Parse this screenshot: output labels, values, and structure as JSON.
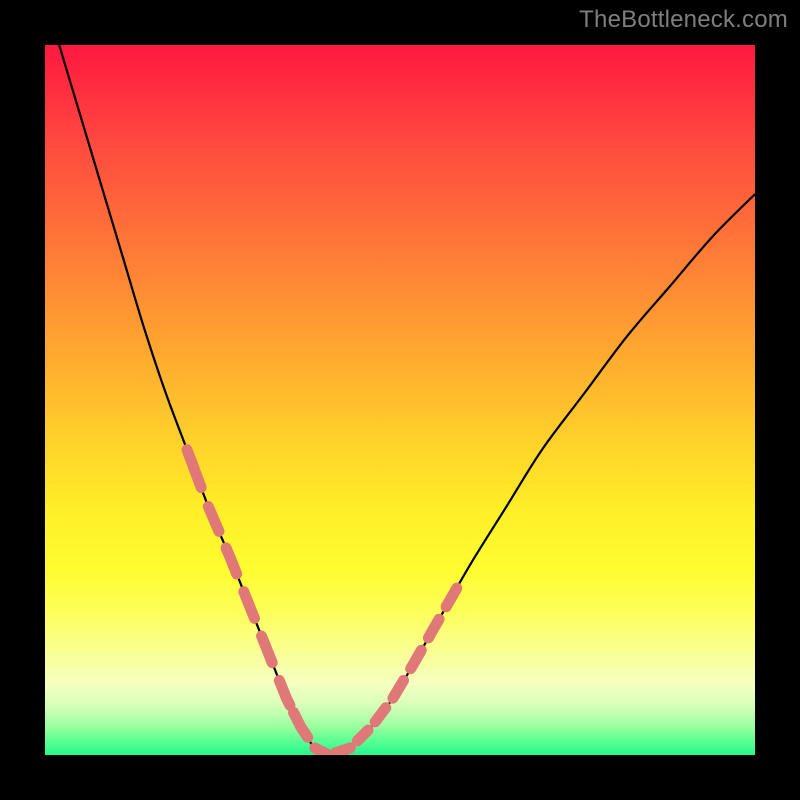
{
  "watermark": "TheBottleneck.com",
  "colors": {
    "frame": "#000000",
    "watermark_text": "#7e7e7e",
    "curve": "#000000",
    "dash": "#e07878",
    "gradient_top": "#ff1840",
    "gradient_bottom": "#22f98d"
  },
  "chart_data": {
    "type": "line",
    "title": "",
    "xlabel": "",
    "ylabel": "",
    "xlim": [
      0,
      100
    ],
    "ylim": [
      0,
      100
    ],
    "grid": false,
    "legend": false,
    "annotations": [],
    "series": [
      {
        "name": "bottleneck-curve",
        "x": [
          2,
          5,
          8,
          11,
          14,
          17,
          20,
          23,
          26,
          28,
          30,
          32,
          34,
          36,
          38,
          40,
          43,
          46,
          49,
          52,
          56,
          60,
          65,
          70,
          76,
          82,
          88,
          94,
          100
        ],
        "y": [
          100,
          90,
          80,
          70,
          60,
          51,
          43,
          35,
          28,
          23,
          18,
          13,
          8,
          4,
          1,
          0,
          1,
          4,
          8,
          13,
          20,
          27,
          35,
          43,
          51,
          59,
          66,
          73,
          79
        ]
      }
    ],
    "dash_segments": {
      "left": [
        {
          "x_start": 20,
          "x_end": 22
        },
        {
          "x_start": 23,
          "x_end": 24.5
        },
        {
          "x_start": 25.5,
          "x_end": 27
        },
        {
          "x_start": 28,
          "x_end": 29.5
        },
        {
          "x_start": 30.5,
          "x_end": 32
        },
        {
          "x_start": 33,
          "x_end": 34.5
        }
      ],
      "floor": [
        {
          "x_start": 35,
          "x_end": 37
        },
        {
          "x_start": 38,
          "x_end": 40
        },
        {
          "x_start": 41,
          "x_end": 43
        }
      ],
      "right": [
        {
          "x_start": 44,
          "x_end": 45.5
        },
        {
          "x_start": 46.5,
          "x_end": 48
        },
        {
          "x_start": 49,
          "x_end": 50.5
        },
        {
          "x_start": 51.5,
          "x_end": 53
        },
        {
          "x_start": 54,
          "x_end": 55.5
        },
        {
          "x_start": 56.5,
          "x_end": 58
        }
      ]
    }
  }
}
